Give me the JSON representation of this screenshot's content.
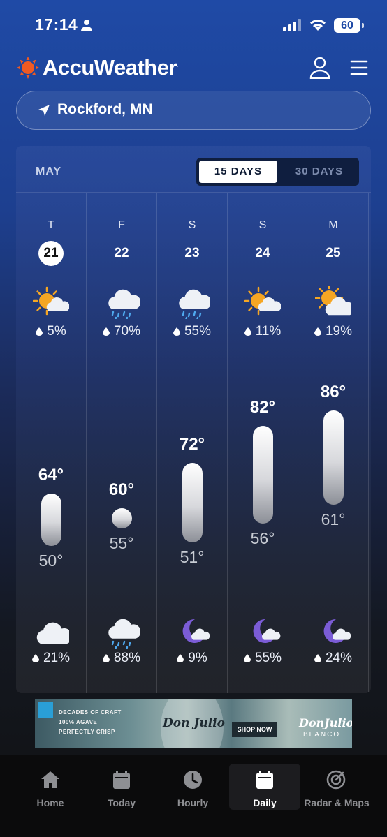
{
  "status_bar": {
    "time": "17:14",
    "battery": "60"
  },
  "header": {
    "brand": "AccuWeather",
    "brand_mark": "."
  },
  "location": {
    "name": "Rockford, MN"
  },
  "forecast": {
    "month": "MAY",
    "toggle": {
      "active": "15 DAYS",
      "inactive": "30 DAYS"
    },
    "days": [
      {
        "dow": "T",
        "date": "21",
        "today": true,
        "day_icon": "partly-sunny-icon",
        "day_precip": "5%",
        "high": "64°",
        "low": "50°",
        "high_value": 64,
        "low_value": 50,
        "night_icon": "cloudy-icon",
        "night_precip": "21%"
      },
      {
        "dow": "F",
        "date": "22",
        "today": false,
        "day_icon": "rain-cloud-icon",
        "day_precip": "70%",
        "high": "60°",
        "low": "55°",
        "high_value": 60,
        "low_value": 55,
        "night_icon": "rain-cloud-icon",
        "night_precip": "88%"
      },
      {
        "dow": "S",
        "date": "23",
        "today": false,
        "day_icon": "rain-cloud-icon",
        "day_precip": "55%",
        "high": "72°",
        "low": "51°",
        "high_value": 72,
        "low_value": 51,
        "night_icon": "moon-cloud-icon",
        "night_precip": "9%"
      },
      {
        "dow": "S",
        "date": "24",
        "today": false,
        "day_icon": "partly-sunny-icon",
        "day_precip": "11%",
        "high": "82°",
        "low": "56°",
        "high_value": 82,
        "low_value": 56,
        "night_icon": "moon-cloud-icon",
        "night_precip": "55%"
      },
      {
        "dow": "M",
        "date": "25",
        "today": false,
        "day_icon": "mostly-cloudy-sun-icon",
        "day_precip": "19%",
        "high": "86°",
        "low": "61°",
        "high_value": 86,
        "low_value": 61,
        "night_icon": "moon-cloud-icon",
        "night_precip": "24%"
      }
    ]
  },
  "ad": {
    "tagline_1": "DECADES OF CRAFT",
    "tagline_2": "100% AGAVE",
    "tagline_3": "PERFECTLY CRISP",
    "brand": "Don Julio",
    "cta": "SHOP NOW",
    "brand_2": "DonJulio",
    "brand_2_sub": "BLANCO"
  },
  "nav": {
    "tabs": [
      {
        "label": "Home",
        "icon": "home-icon",
        "active": false
      },
      {
        "label": "Today",
        "icon": "calendar-icon",
        "active": false
      },
      {
        "label": "Hourly",
        "icon": "clock-icon",
        "active": false
      },
      {
        "label": "Daily",
        "icon": "calendar-icon",
        "active": true
      },
      {
        "label": "Radar & Maps",
        "icon": "radar-icon",
        "active": false
      }
    ]
  },
  "colors": {
    "sun": "#f6a623",
    "logo_orange": "#f05a22",
    "rain_drop": "#4fa9ef",
    "moon": "#7b5cd6"
  }
}
